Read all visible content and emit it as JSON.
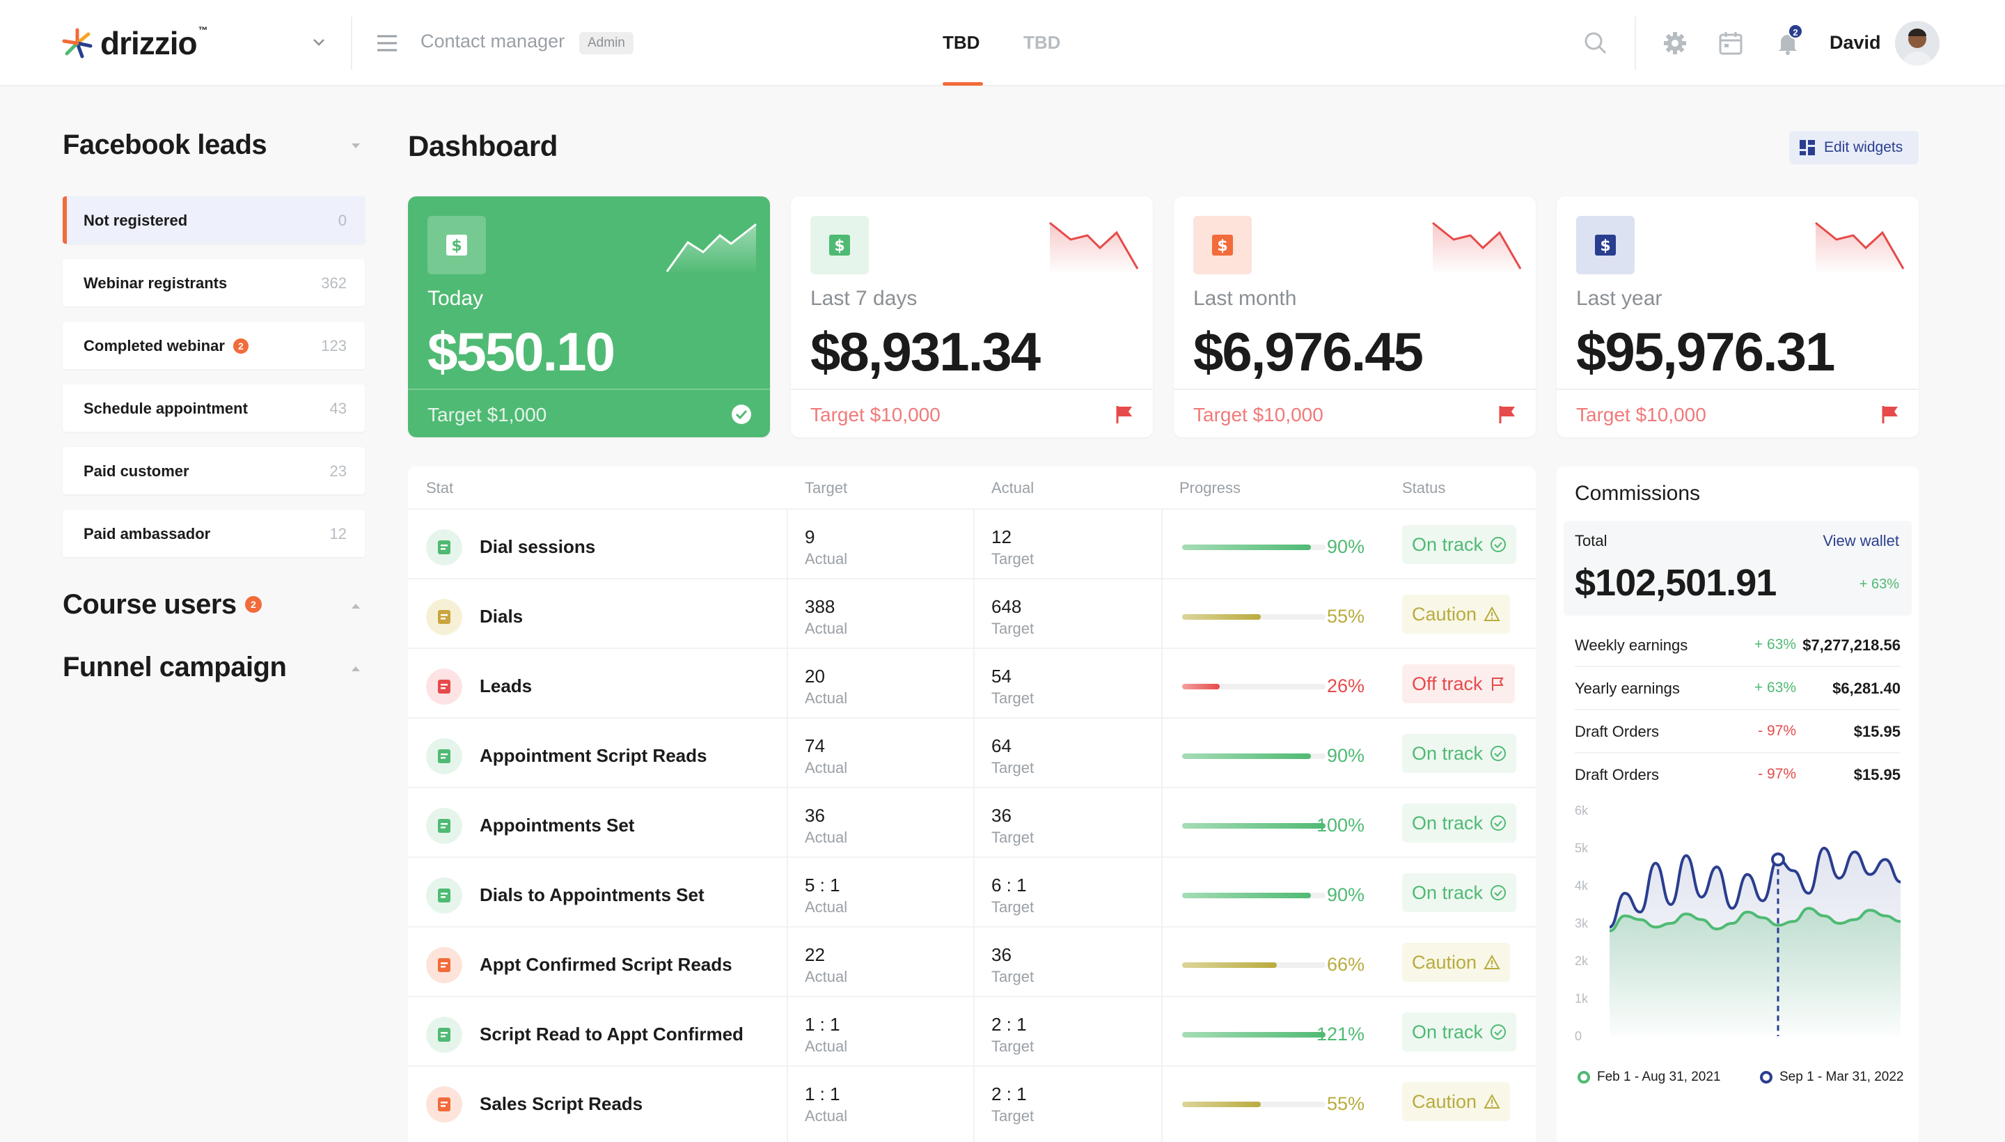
{
  "header": {
    "brand": "drizzio",
    "brand_mark": "™",
    "app_name": "Contact manager",
    "role": "Admin",
    "tabs": [
      {
        "label": "TBD",
        "active": true
      },
      {
        "label": "TBD",
        "active": false
      }
    ],
    "notification_count": "2",
    "user_name": "David",
    "icons": [
      "search-icon",
      "gear-icon",
      "calendar-icon",
      "bell-icon"
    ]
  },
  "sidebar": {
    "sections": [
      {
        "title": "Facebook leads",
        "expanded": true
      },
      {
        "title": "Course users",
        "badge": "2",
        "expanded": false
      },
      {
        "title": "Funnel campaign",
        "expanded": false
      }
    ],
    "items": [
      {
        "label": "Not registered",
        "count": "0",
        "active": true
      },
      {
        "label": "Webinar registrants",
        "count": "362"
      },
      {
        "label": "Completed webinar",
        "count": "123",
        "badge": "2"
      },
      {
        "label": "Schedule appointment",
        "count": "43"
      },
      {
        "label": "Paid customer",
        "count": "23"
      },
      {
        "label": "Paid ambassador",
        "count": "12"
      }
    ]
  },
  "dashboard": {
    "title": "Dashboard",
    "edit_label": "Edit widgets",
    "cards": [
      {
        "label": "Today",
        "value": "$550.10",
        "target": "Target $1,000",
        "trend": "up",
        "status": "met"
      },
      {
        "label": "Last 7 days",
        "value": "$8,931.34",
        "target": "Target $10,000",
        "trend": "down",
        "status": "flag"
      },
      {
        "label": "Last month",
        "value": "$6,976.45",
        "target": "Target $10,000",
        "trend": "down",
        "status": "flag"
      },
      {
        "label": "Last year",
        "value": "$95,976.31",
        "target": "Target $10,000",
        "trend": "down",
        "status": "flag"
      }
    ]
  },
  "stats": {
    "columns": [
      "Stat",
      "Target",
      "Actual",
      "Progress",
      "Status"
    ],
    "rows": [
      {
        "name": "Dial sessions",
        "target": "9",
        "target_sub": "Actual",
        "actual": "12",
        "actual_sub": "Target",
        "progress": 90,
        "pct": "90%",
        "status": "On track",
        "state": "on",
        "icon": "headset-icon"
      },
      {
        "name": "Dials",
        "target": "388",
        "target_sub": "Actual",
        "actual": "648",
        "actual_sub": "Target",
        "progress": 55,
        "pct": "55%",
        "status": "Caution",
        "state": "caution",
        "icon": "phone-icon"
      },
      {
        "name": "Leads",
        "target": "20",
        "target_sub": "Actual",
        "actual": "54",
        "actual_sub": "Target",
        "progress": 26,
        "pct": "26%",
        "status": "Off track",
        "state": "off",
        "icon": "lifebuoy-icon"
      },
      {
        "name": "Appointment Script Reads",
        "target": "74",
        "target_sub": "Actual",
        "actual": "64",
        "actual_sub": "Target",
        "progress": 90,
        "pct": "90%",
        "status": "On track",
        "state": "on",
        "icon": "script-icon"
      },
      {
        "name": "Appointments Set",
        "target": "36",
        "target_sub": "Actual",
        "actual": "36",
        "actual_sub": "Target",
        "progress": 100,
        "pct": "100%",
        "status": "On track",
        "state": "on",
        "icon": "calendar-check-icon"
      },
      {
        "name": "Dials to Appointments Set",
        "target": "5 : 1",
        "target_sub": "Actual",
        "actual": "6 : 1",
        "actual_sub": "Target",
        "progress": 90,
        "pct": "90%",
        "status": "On track",
        "state": "on",
        "icon": "calendar-grid-icon"
      },
      {
        "name": "Appt Confirmed Script Reads",
        "target": "22",
        "target_sub": "Actual",
        "actual": "36",
        "actual_sub": "Target",
        "progress": 66,
        "pct": "66%",
        "status": "Caution",
        "state": "caution",
        "icon": "calendar-orange-icon"
      },
      {
        "name": "Script Read to Appt Confirmed",
        "target": "1 : 1",
        "target_sub": "Actual",
        "actual": "2 : 1",
        "actual_sub": "Target",
        "progress": 100,
        "pct": "121%",
        "status": "On track",
        "state": "on",
        "icon": "calendar-green-icon"
      },
      {
        "name": "Sales Script Reads",
        "target": "1 : 1",
        "target_sub": "Actual",
        "actual": "2 : 1",
        "actual_sub": "Target",
        "progress": 55,
        "pct": "55%",
        "status": "Caution",
        "state": "caution",
        "icon": "quote-icon"
      }
    ]
  },
  "commissions": {
    "title": "Commissions",
    "total_label": "Total",
    "wallet_label": "View wallet",
    "total_value": "$102,501.91",
    "total_change": "+ 63%",
    "earnings": [
      {
        "label": "Weekly earnings",
        "change": "+ 63%",
        "value": "$7,277,218.56",
        "direction": "up"
      },
      {
        "label": "Yearly earnings",
        "change": "+ 63%",
        "value": "$6,281.40",
        "direction": "up"
      },
      {
        "label": "Draft Orders",
        "change": "- 97%",
        "value": "$15.95",
        "direction": "down"
      },
      {
        "label": "Draft Orders",
        "change": "- 97%",
        "value": "$15.95",
        "direction": "down"
      }
    ]
  },
  "chart_data": {
    "type": "area",
    "yticks": [
      "6k",
      "5k",
      "4k",
      "3k",
      "2k",
      "1k",
      "0"
    ],
    "ylim": [
      0,
      6000
    ],
    "series": [
      {
        "name": "Feb 1 - Aug 31, 2021",
        "color": "#4fba73",
        "values": [
          2800,
          3200,
          3100,
          2900,
          3000,
          3250,
          3100,
          2850,
          3000,
          3300,
          3150,
          2950,
          3050,
          3400,
          3200,
          3000,
          3100,
          3350,
          3200,
          3050
        ]
      },
      {
        "name": "Sep 1 - Mar 31, 2022",
        "color": "#2a3e8f",
        "values": [
          2900,
          3800,
          3300,
          4600,
          3500,
          4800,
          3700,
          4500,
          3400,
          4300,
          3600,
          4700,
          4400,
          3800,
          5000,
          4200,
          4900,
          4300,
          4700,
          4100
        ]
      }
    ],
    "marker_index": 11,
    "legend_placement": "bottom"
  },
  "colors": {
    "accent": "#f26b3a",
    "green": "#4fba73",
    "navy": "#2a3e8f",
    "red": "#e64a4a",
    "olive": "#b9ab3e"
  }
}
